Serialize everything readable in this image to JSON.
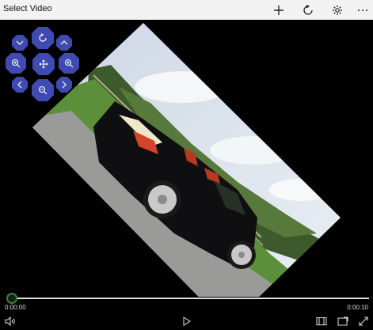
{
  "window": {
    "title": "Select Video"
  },
  "toolbar": [
    {
      "name": "add-icon",
      "label": "+"
    },
    {
      "name": "refresh-icon",
      "label": ""
    },
    {
      "name": "settings-icon",
      "label": ""
    },
    {
      "name": "more-icon",
      "label": "···"
    }
  ],
  "controls": [
    {
      "name": "chevron-down-icon"
    },
    {
      "name": "rotate-icon"
    },
    {
      "name": "chevron-up-icon"
    },
    {
      "name": "zoom-in-icon"
    },
    {
      "name": "move-icon"
    },
    {
      "name": "zoom-in-icon"
    },
    {
      "name": "chevron-left-icon"
    },
    {
      "name": "zoom-out-icon"
    },
    {
      "name": "chevron-right-icon"
    }
  ],
  "player": {
    "current_time": "0:00:00",
    "duration": "0:00:10",
    "progress": 0.0
  },
  "bottom_bar": [
    {
      "name": "volume-icon"
    },
    {
      "name": "play-icon"
    },
    {
      "name": "compact-overlay-icon"
    },
    {
      "name": "cast-icon"
    },
    {
      "name": "fullscreen-icon"
    }
  ],
  "colors": {
    "accent": "#3f4bb0",
    "seek_thumb_ring": "#2e8b2e",
    "titlebar": "#f2f2f2"
  }
}
